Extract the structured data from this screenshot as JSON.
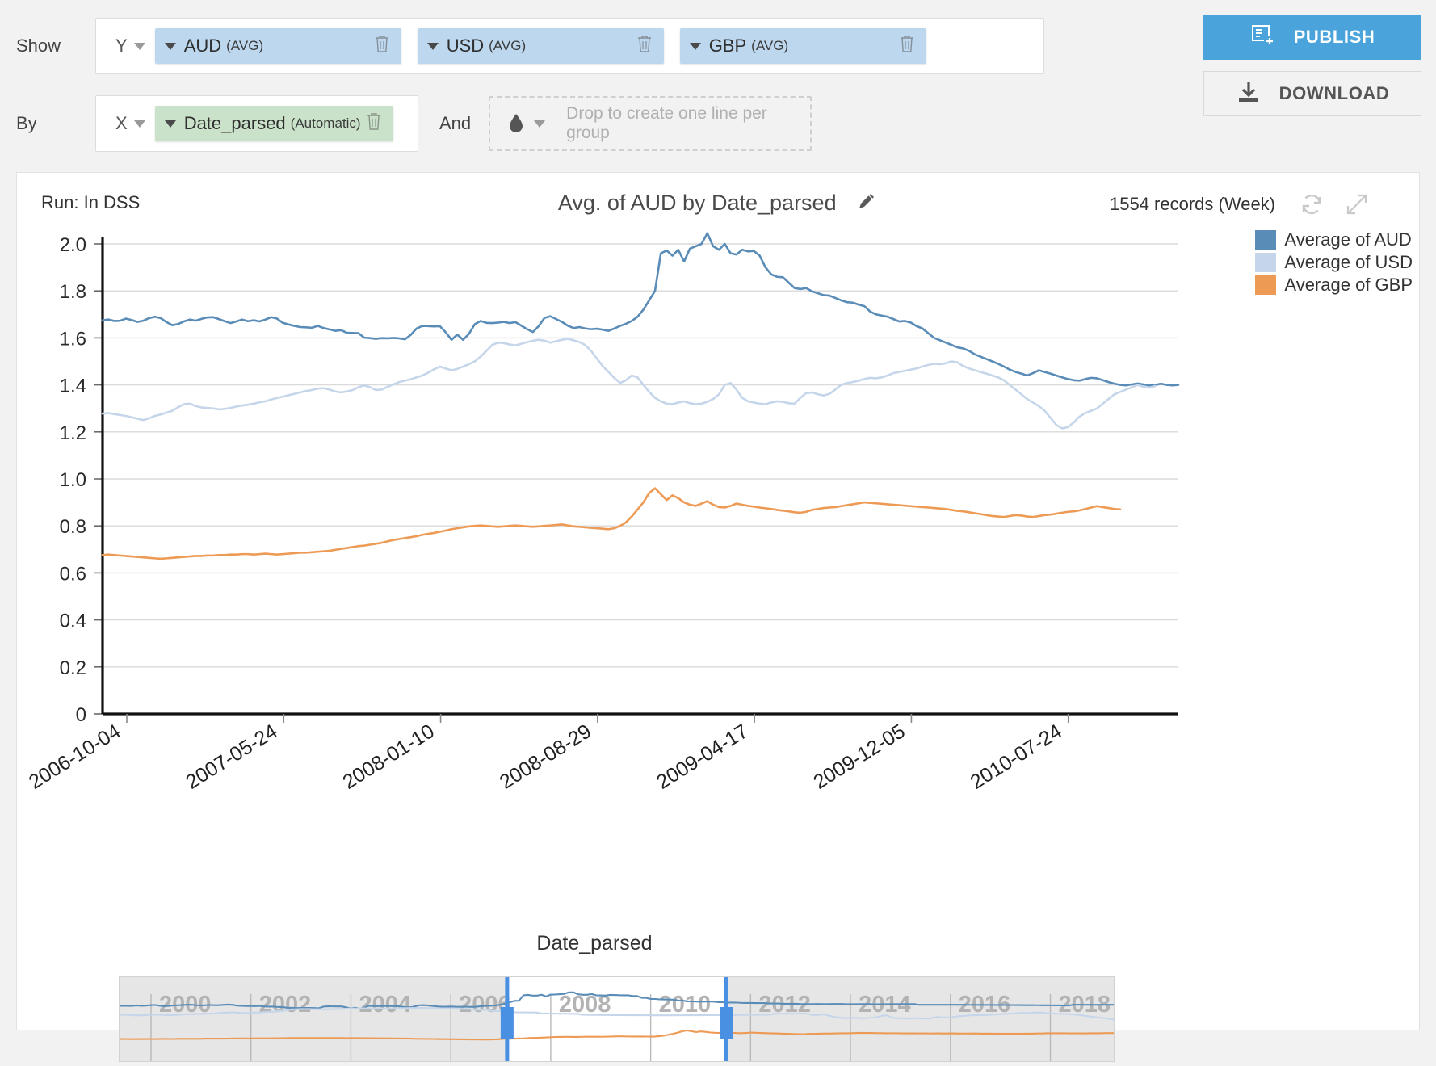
{
  "controls": {
    "show_label": "Show",
    "by_label": "By",
    "and_label": "And",
    "y_axis_tag": "Y",
    "x_axis_tag": "X",
    "measures": [
      {
        "name": "AUD",
        "agg": "(AVG)"
      },
      {
        "name": "USD",
        "agg": "(AVG)"
      },
      {
        "name": "GBP",
        "agg": "(AVG)"
      }
    ],
    "dimension": {
      "name": "Date_parsed",
      "agg": "(Automatic)"
    },
    "dropzone_placeholder": "Drop to create one line per group",
    "chip_measure_color": "#bdd7ee",
    "chip_dimension_color": "#c9e2c9"
  },
  "actions": {
    "publish_label": "PUBLISH",
    "download_label": "DOWNLOAD",
    "publish_color": "#4aa3db"
  },
  "card": {
    "run_label": "Run: In DSS",
    "title": "Avg. of AUD by Date_parsed",
    "records_label": "1554 records (Week)",
    "edit_icon": "pencil-icon",
    "refresh_icon": "refresh-icon",
    "expand_icon": "expand-icon"
  },
  "chart_data": {
    "type": "line",
    "title": "Avg. of AUD by Date_parsed",
    "xlabel": "Date_parsed",
    "ylabel": "",
    "ylim": [
      0,
      2.0
    ],
    "yticks": [
      "0",
      "0.2",
      "0.4",
      "0.6",
      "0.8",
      "1.0",
      "1.2",
      "1.4",
      "1.6",
      "1.8",
      "2.0"
    ],
    "xticks": [
      "2006-10-04",
      "2007-05-24",
      "2008-01-10",
      "2008-08-29",
      "2009-04-17",
      "2009-12-05",
      "2010-07-24"
    ],
    "grid": true,
    "legend_position": "right",
    "legend": [
      "Average of AUD",
      "Average of USD",
      "Average of GBP"
    ],
    "colors": {
      "aud": "#5a8cb8",
      "usd": "#c5d6ea",
      "gbp": "#ed9a55"
    },
    "series": [
      {
        "name": "Average of AUD",
        "color": "#5a8cb8",
        "values": [
          1.675,
          1.678,
          1.672,
          1.673,
          1.682,
          1.676,
          1.668,
          1.673,
          1.684,
          1.69,
          1.684,
          1.667,
          1.654,
          1.659,
          1.67,
          1.678,
          1.673,
          1.681,
          1.687,
          1.688,
          1.68,
          1.671,
          1.663,
          1.67,
          1.678,
          1.671,
          1.675,
          1.67,
          1.678,
          1.688,
          1.682,
          1.664,
          1.657,
          1.651,
          1.646,
          1.645,
          1.643,
          1.651,
          1.642,
          1.636,
          1.63,
          1.633,
          1.622,
          1.621,
          1.62,
          1.601,
          1.599,
          1.596,
          1.599,
          1.598,
          1.6,
          1.598,
          1.594,
          1.613,
          1.64,
          1.651,
          1.65,
          1.649,
          1.65,
          1.624,
          1.592,
          1.614,
          1.592,
          1.617,
          1.658,
          1.672,
          1.664,
          1.663,
          1.665,
          1.668,
          1.663,
          1.667,
          1.652,
          1.637,
          1.625,
          1.65,
          1.685,
          1.692,
          1.68,
          1.668,
          1.652,
          1.642,
          1.646,
          1.64,
          1.637,
          1.639,
          1.635,
          1.63,
          1.64,
          1.651,
          1.66,
          1.672,
          1.69,
          1.72,
          1.76,
          1.8,
          1.96,
          1.972,
          1.95,
          1.975,
          1.925,
          1.98,
          1.99,
          2.0,
          2.045,
          1.99,
          1.975,
          2.0,
          1.96,
          1.955,
          1.975,
          1.968,
          1.97,
          1.95,
          1.9,
          1.87,
          1.86,
          1.858,
          1.835,
          1.812,
          1.808,
          1.812,
          1.798,
          1.79,
          1.782,
          1.78,
          1.77,
          1.76,
          1.752,
          1.75,
          1.742,
          1.735,
          1.712,
          1.7,
          1.695,
          1.69,
          1.68,
          1.67,
          1.672,
          1.665,
          1.65,
          1.64,
          1.62,
          1.6,
          1.59,
          1.58,
          1.57,
          1.56,
          1.555,
          1.545,
          1.53,
          1.52,
          1.51,
          1.5,
          1.49,
          1.478,
          1.465,
          1.455,
          1.448,
          1.44,
          1.45,
          1.462,
          1.455,
          1.448,
          1.44,
          1.432,
          1.425,
          1.42,
          1.418,
          1.425,
          1.43,
          1.428,
          1.42,
          1.412,
          1.405,
          1.4,
          1.398,
          1.402,
          1.406,
          1.402,
          1.398,
          1.4,
          1.405,
          1.4,
          1.398,
          1.4
        ]
      },
      {
        "name": "Average of USD",
        "color": "#c5d6ea",
        "values": [
          1.278,
          1.28,
          1.276,
          1.272,
          1.268,
          1.262,
          1.256,
          1.25,
          1.258,
          1.268,
          1.274,
          1.282,
          1.29,
          1.305,
          1.318,
          1.32,
          1.31,
          1.304,
          1.302,
          1.3,
          1.296,
          1.298,
          1.302,
          1.308,
          1.312,
          1.316,
          1.32,
          1.326,
          1.33,
          1.338,
          1.344,
          1.35,
          1.356,
          1.362,
          1.368,
          1.374,
          1.378,
          1.384,
          1.386,
          1.38,
          1.372,
          1.368,
          1.372,
          1.378,
          1.39,
          1.398,
          1.39,
          1.378,
          1.38,
          1.392,
          1.402,
          1.412,
          1.418,
          1.424,
          1.432,
          1.44,
          1.452,
          1.466,
          1.478,
          1.47,
          1.462,
          1.468,
          1.478,
          1.488,
          1.5,
          1.52,
          1.545,
          1.57,
          1.58,
          1.578,
          1.572,
          1.568,
          1.575,
          1.582,
          1.588,
          1.592,
          1.588,
          1.58,
          1.586,
          1.592,
          1.596,
          1.59,
          1.582,
          1.57,
          1.545,
          1.512,
          1.48,
          1.455,
          1.43,
          1.408,
          1.42,
          1.44,
          1.432,
          1.4,
          1.37,
          1.345,
          1.33,
          1.32,
          1.318,
          1.325,
          1.33,
          1.322,
          1.318,
          1.32,
          1.328,
          1.34,
          1.36,
          1.4,
          1.408,
          1.38,
          1.345,
          1.33,
          1.325,
          1.32,
          1.318,
          1.325,
          1.33,
          1.328,
          1.322,
          1.32,
          1.345,
          1.365,
          1.368,
          1.36,
          1.355,
          1.362,
          1.38,
          1.4,
          1.408,
          1.412,
          1.418,
          1.425,
          1.43,
          1.428,
          1.432,
          1.44,
          1.45,
          1.455,
          1.46,
          1.465,
          1.47,
          1.478,
          1.485,
          1.49,
          1.488,
          1.492,
          1.5,
          1.496,
          1.48,
          1.47,
          1.462,
          1.455,
          1.448,
          1.44,
          1.432,
          1.42,
          1.4,
          1.38,
          1.36,
          1.34,
          1.325,
          1.31,
          1.29,
          1.26,
          1.23,
          1.215,
          1.22,
          1.24,
          1.265,
          1.28,
          1.29,
          1.3,
          1.32,
          1.34,
          1.36,
          1.37,
          1.38,
          1.39,
          1.4,
          1.392,
          1.388,
          1.395
        ]
      },
      {
        "name": "Average of GBP",
        "color": "#ed9a55",
        "values": [
          0.676,
          0.678,
          0.676,
          0.674,
          0.672,
          0.67,
          0.668,
          0.666,
          0.664,
          0.662,
          0.66,
          0.662,
          0.664,
          0.666,
          0.668,
          0.67,
          0.672,
          0.672,
          0.674,
          0.674,
          0.676,
          0.676,
          0.678,
          0.678,
          0.68,
          0.68,
          0.678,
          0.68,
          0.682,
          0.68,
          0.678,
          0.68,
          0.682,
          0.684,
          0.686,
          0.686,
          0.688,
          0.69,
          0.692,
          0.694,
          0.698,
          0.702,
          0.706,
          0.71,
          0.714,
          0.716,
          0.72,
          0.724,
          0.728,
          0.734,
          0.74,
          0.744,
          0.748,
          0.752,
          0.756,
          0.762,
          0.766,
          0.77,
          0.775,
          0.78,
          0.786,
          0.79,
          0.794,
          0.798,
          0.8,
          0.802,
          0.8,
          0.798,
          0.796,
          0.798,
          0.8,
          0.802,
          0.8,
          0.798,
          0.796,
          0.798,
          0.8,
          0.802,
          0.804,
          0.806,
          0.802,
          0.798,
          0.796,
          0.794,
          0.792,
          0.79,
          0.788,
          0.786,
          0.79,
          0.8,
          0.815,
          0.84,
          0.87,
          0.9,
          0.94,
          0.96,
          0.935,
          0.91,
          0.93,
          0.918,
          0.9,
          0.89,
          0.885,
          0.895,
          0.905,
          0.89,
          0.88,
          0.878,
          0.885,
          0.895,
          0.89,
          0.885,
          0.882,
          0.878,
          0.875,
          0.872,
          0.868,
          0.865,
          0.862,
          0.858,
          0.856,
          0.86,
          0.868,
          0.872,
          0.876,
          0.878,
          0.88,
          0.884,
          0.888,
          0.892,
          0.896,
          0.9,
          0.898,
          0.896,
          0.894,
          0.892,
          0.89,
          0.888,
          0.886,
          0.884,
          0.882,
          0.88,
          0.878,
          0.876,
          0.874,
          0.872,
          0.868,
          0.864,
          0.862,
          0.858,
          0.854,
          0.85,
          0.846,
          0.842,
          0.84,
          0.838,
          0.842,
          0.846,
          0.844,
          0.84,
          0.838,
          0.842,
          0.846,
          0.848,
          0.852,
          0.856,
          0.86,
          0.862,
          0.866,
          0.872,
          0.878,
          0.884,
          0.88,
          0.876,
          0.872,
          0.87
        ]
      }
    ],
    "navigator": {
      "year_ticks": [
        "2000",
        "2002",
        "2004",
        "2006",
        "2008",
        "2010",
        "2012",
        "2014",
        "2016",
        "2018"
      ],
      "selection_start_pct": 39.0,
      "selection_end_pct": 61.0,
      "handle_color": "#4a90e2"
    }
  }
}
